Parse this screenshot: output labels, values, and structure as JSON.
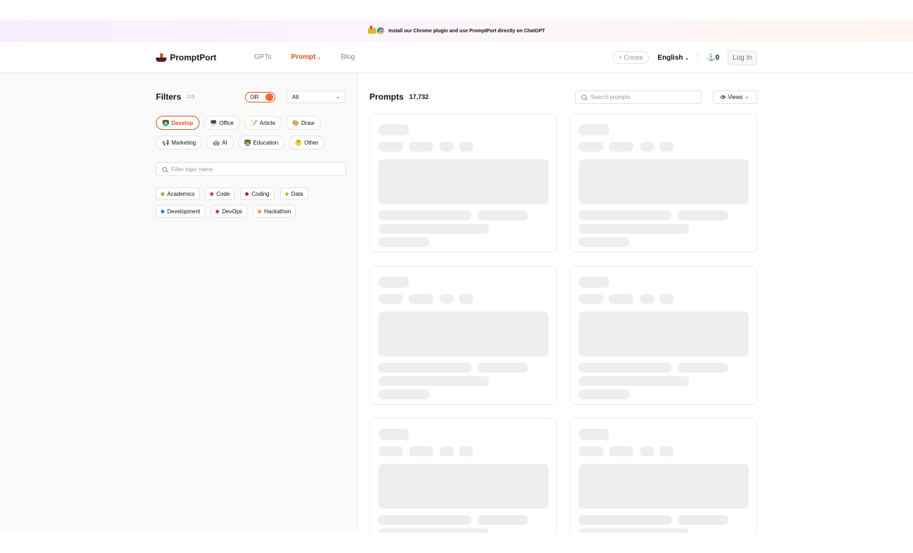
{
  "banner": {
    "text": "Install our Chrome plugin and use PromptPort directly on ChatGPT"
  },
  "header": {
    "logo": "PromptPort",
    "nav": [
      {
        "label": "GPTs",
        "active": false
      },
      {
        "label": "Prompt",
        "active": true
      },
      {
        "label": "Blog",
        "active": false
      }
    ],
    "create_label": "+ Create",
    "language": "English",
    "anchor_count": "0",
    "login_label": "Log In"
  },
  "filters": {
    "title": "Filters",
    "count": "119",
    "toggle_label": "OR",
    "select_value": "All",
    "categories": [
      {
        "emoji": "👩‍💻",
        "label": "Develop",
        "active": true
      },
      {
        "emoji": "🖥️",
        "label": "Office",
        "active": false
      },
      {
        "emoji": "📝",
        "label": "Article",
        "active": false
      },
      {
        "emoji": "🎨",
        "label": "Draw",
        "active": false
      },
      {
        "emoji": "📢",
        "label": "Marketing",
        "active": false
      },
      {
        "emoji": "🤖",
        "label": "AI",
        "active": false
      },
      {
        "emoji": "👨‍🏫",
        "label": "Education",
        "active": false
      },
      {
        "emoji": "🤔",
        "label": "Other",
        "active": false
      }
    ],
    "topic_placeholder": "Filter topic name",
    "topics": [
      {
        "label": "Academics",
        "color": "#6cc04a"
      },
      {
        "label": "Code",
        "color": "#d6336c"
      },
      {
        "label": "Coding",
        "color": "#a61e6e"
      },
      {
        "label": "Data",
        "color": "#94d82d"
      },
      {
        "label": "Development",
        "color": "#1c7ed6"
      },
      {
        "label": "DevOps",
        "color": "#e03131"
      },
      {
        "label": "Hackathon",
        "color": "#f59f00"
      }
    ]
  },
  "prompts": {
    "title": "Prompts",
    "count": "17,732",
    "search_placeholder": "Search prompts",
    "views_label": "Views"
  },
  "colors": {
    "accent": "#e0541f",
    "skeleton": "#eeeeee"
  }
}
